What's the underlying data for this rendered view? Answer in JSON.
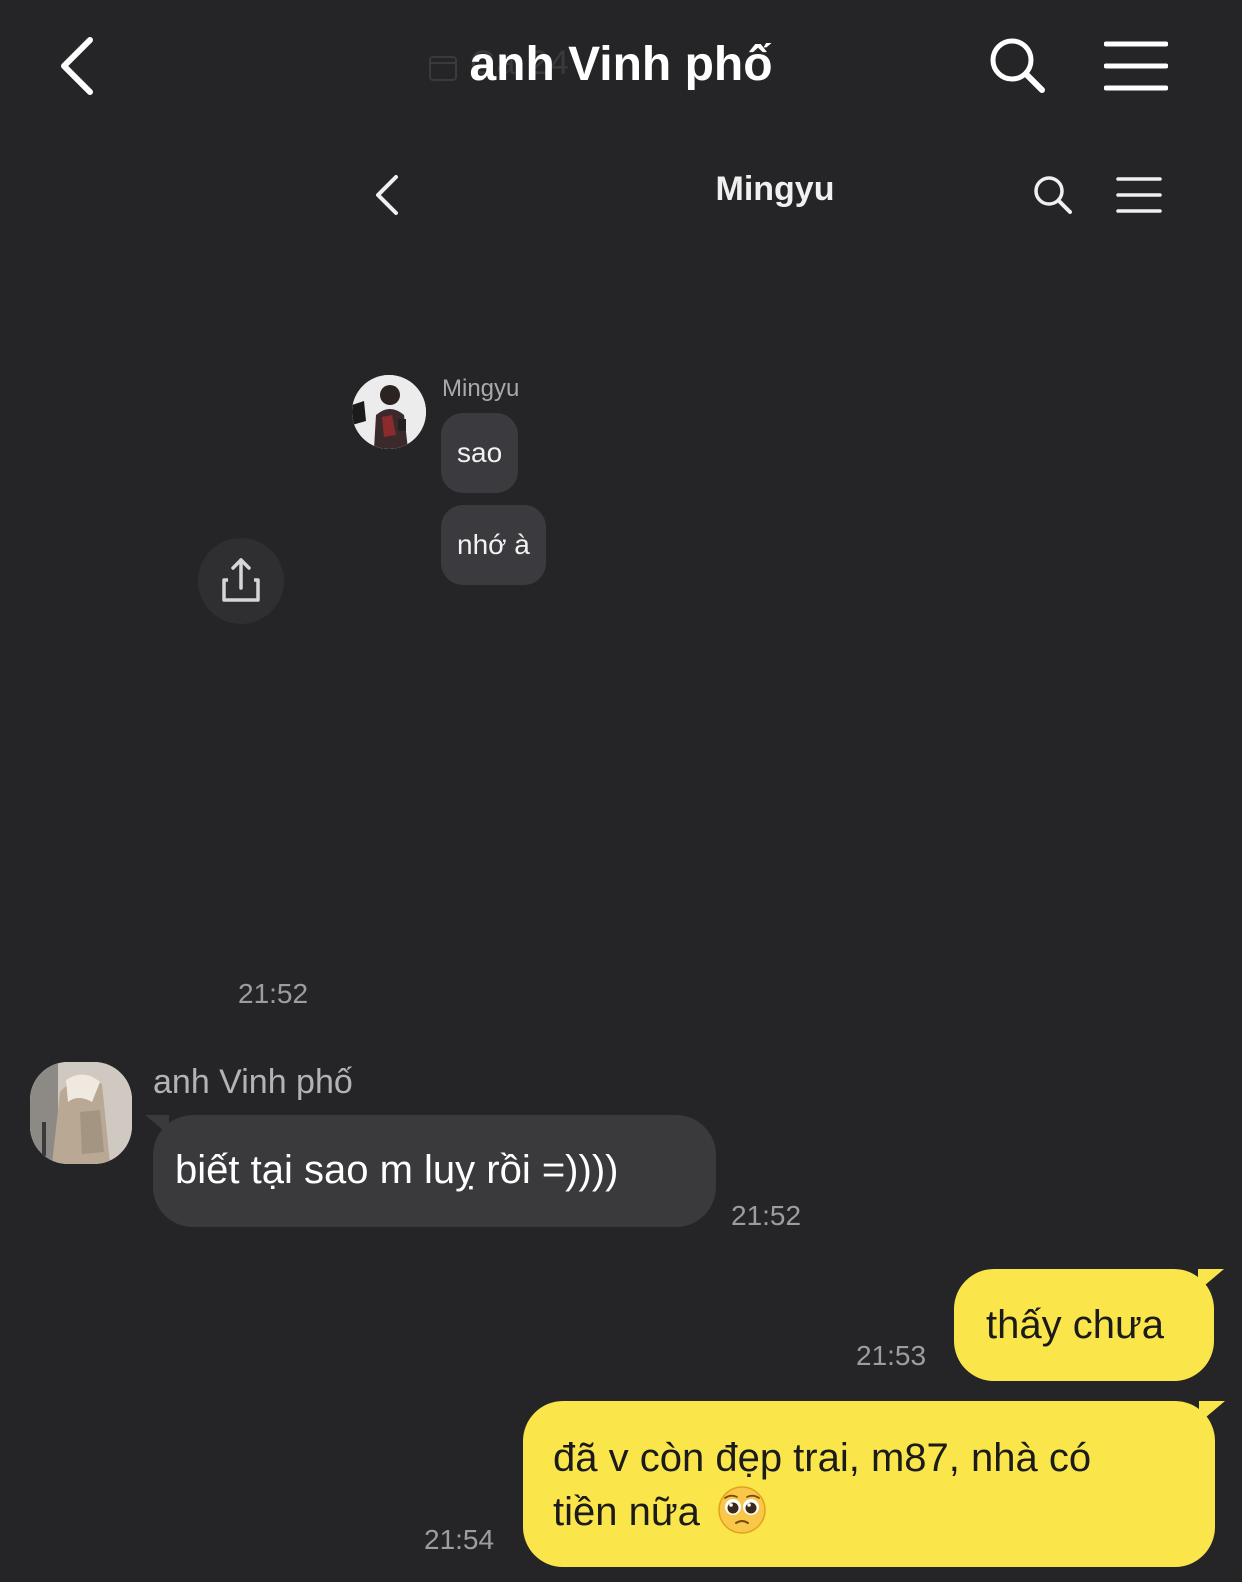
{
  "header": {
    "title": "anh Vinh phố",
    "ghost_date": "Ca  24"
  },
  "inner": {
    "title": "Mingyu",
    "sender": "Mingyu",
    "messages": [
      "sao",
      "nhớ à"
    ],
    "time": "21:52"
  },
  "chat": {
    "sender": "anh Vinh phố",
    "incoming": {
      "text": "biết tại sao m luỵ rồi =))))",
      "time": "21:52"
    },
    "outgoing": [
      {
        "text": "thấy chưa",
        "time": "21:53"
      },
      {
        "text_line1": "đã v còn đẹp trai, m87, nhà có",
        "text_line2": "tiền nữa",
        "time": "21:54"
      }
    ]
  },
  "icons": {
    "back": "chevron-left-icon",
    "search": "search-icon",
    "menu": "hamburger-menu-icon",
    "share": "share-icon",
    "emoji": "pleading-face-emoji"
  },
  "colors": {
    "background": "#252527",
    "incoming_bubble": "#3a3a3d",
    "outgoing_bubble": "#fae64a"
  }
}
